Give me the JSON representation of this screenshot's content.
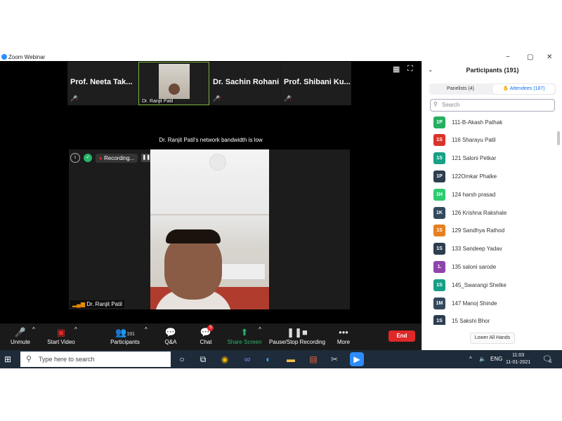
{
  "window": {
    "title": "Zoom Webinar",
    "controls": {
      "minimize": "−",
      "maximize": "▢",
      "close": "✕"
    }
  },
  "gallery": {
    "tiles": [
      {
        "name": "Prof. Neeta Tak...",
        "mic": "muted"
      },
      {
        "name": "Dr. Ranjit Patil",
        "mic": "active",
        "has_video": true
      },
      {
        "name": "Dr. Sachin Rohani",
        "mic": "muted"
      },
      {
        "name": "Prof. Shibani Ku...",
        "mic": "muted"
      }
    ]
  },
  "banner_text": "Dr. Ranjit Patil's network bandwidth is low",
  "main_video": {
    "recording_label": "Recording...",
    "speaker_label": "Dr. Ranjit Patil"
  },
  "toolbar": {
    "unmute": "Unmute",
    "start_video": "Start Video",
    "participants": "Participants",
    "participants_count": "191",
    "qa": "Q&A",
    "chat": "Chat",
    "chat_badge": "5",
    "share_screen": "Share Screen",
    "pause_stop": "Pause/Stop Recording",
    "more": "More",
    "end": "End"
  },
  "panel": {
    "title": "Participants (191)",
    "tab_panelists": "Panelists (4)",
    "tab_attendees": "Attendees (187)",
    "search_placeholder": "Search",
    "lower_all_hands": "Lower All Hands",
    "attendees": [
      {
        "initials": "1P",
        "name": "111-B-Akash Pathak",
        "color": "#27ae60"
      },
      {
        "initials": "1S",
        "name": "116 Sharayu Patil",
        "color": "#d9342b"
      },
      {
        "initials": "1S",
        "name": "121 Saloni Petkar",
        "color": "#16a085"
      },
      {
        "initials": "1P",
        "name": "122Omkar Phalke",
        "color": "#2c3e50"
      },
      {
        "initials": "1H",
        "name": "124 harsh prasad",
        "color": "#2ecc71"
      },
      {
        "initials": "1K",
        "name": "126 Krishna Rakshale",
        "color": "#34495e"
      },
      {
        "initials": "1S",
        "name": "129 Sandhya Rathod",
        "color": "#e67e22"
      },
      {
        "initials": "1S",
        "name": "133 Sandeep Yadav",
        "color": "#2c3e50"
      },
      {
        "initials": "1.",
        "name": "135 saloni sarode",
        "color": "#8e44ad"
      },
      {
        "initials": "1S",
        "name": "145_Swarangi Shelke",
        "color": "#16a085"
      },
      {
        "initials": "1M",
        "name": "147 Manoj Shinde",
        "color": "#34495e"
      },
      {
        "initials": "1S",
        "name": "15 Sakshi Bhor",
        "color": "#2c3e50"
      }
    ]
  },
  "taskbar": {
    "search_text": "Type here to search",
    "lang": "ENG",
    "time": "11:03",
    "date": "11-01-2021",
    "notif_count": "5"
  }
}
